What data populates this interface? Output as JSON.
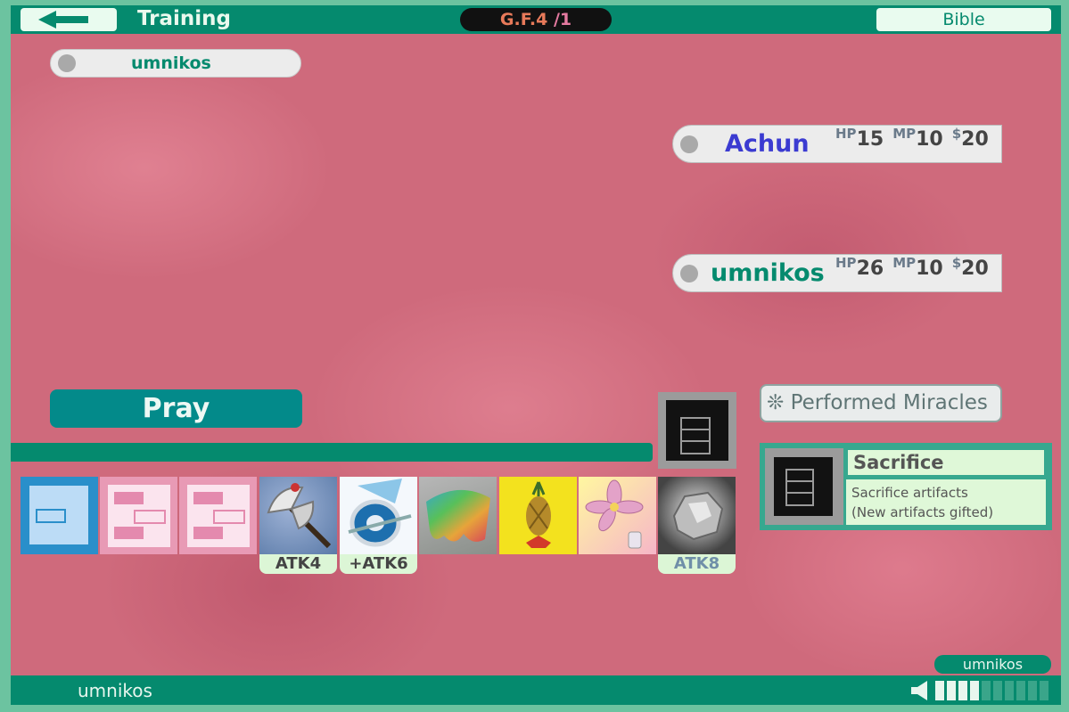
{
  "header": {
    "mode_title": "Training",
    "level_prefix": "G.F.4",
    "level_suffix": " /1",
    "bible_label": "Bible"
  },
  "opponent_pill": {
    "name": "umnikos"
  },
  "players": [
    {
      "name": "Achun",
      "name_color": "#3b3bd1",
      "hp_label": "HP",
      "hp": "15",
      "mp_label": "MP",
      "mp": "10",
      "money_label": "$",
      "money": "20"
    },
    {
      "name": "umnikos",
      "name_color": "#058a6e",
      "hp_label": "HP",
      "hp": "26",
      "mp_label": "MP",
      "mp": "10",
      "money_label": "$",
      "money": "20"
    }
  ],
  "actions": {
    "pray_label": "Pray"
  },
  "hand": [
    {
      "name": "selected-slot",
      "label": ""
    },
    {
      "name": "pink-card-1",
      "label": ""
    },
    {
      "name": "pink-card-2",
      "label": ""
    },
    {
      "name": "axe-artifact",
      "label": "ATK4"
    },
    {
      "name": "shield-artifact",
      "label": "+ATK6"
    },
    {
      "name": "cloak-artifact",
      "label": ""
    },
    {
      "name": "pineapple-artifact",
      "label": ""
    },
    {
      "name": "flower-artifact",
      "label": ""
    },
    {
      "name": "rock-artifact",
      "label": "ATK8"
    }
  ],
  "miracles": {
    "icon": "❊",
    "label": "Performed Miracles"
  },
  "sacrifice": {
    "title": "Sacrifice",
    "desc_line1": "Sacrifice artifacts",
    "desc_line2": "(New artifacts gifted)"
  },
  "footer": {
    "owner_tag": "umnikos",
    "player_name": "umnikos",
    "volume_level": 0.4
  },
  "colors": {
    "accent": "#058a6e",
    "field": "#cf6a7c",
    "teal_button": "#038a8a"
  }
}
